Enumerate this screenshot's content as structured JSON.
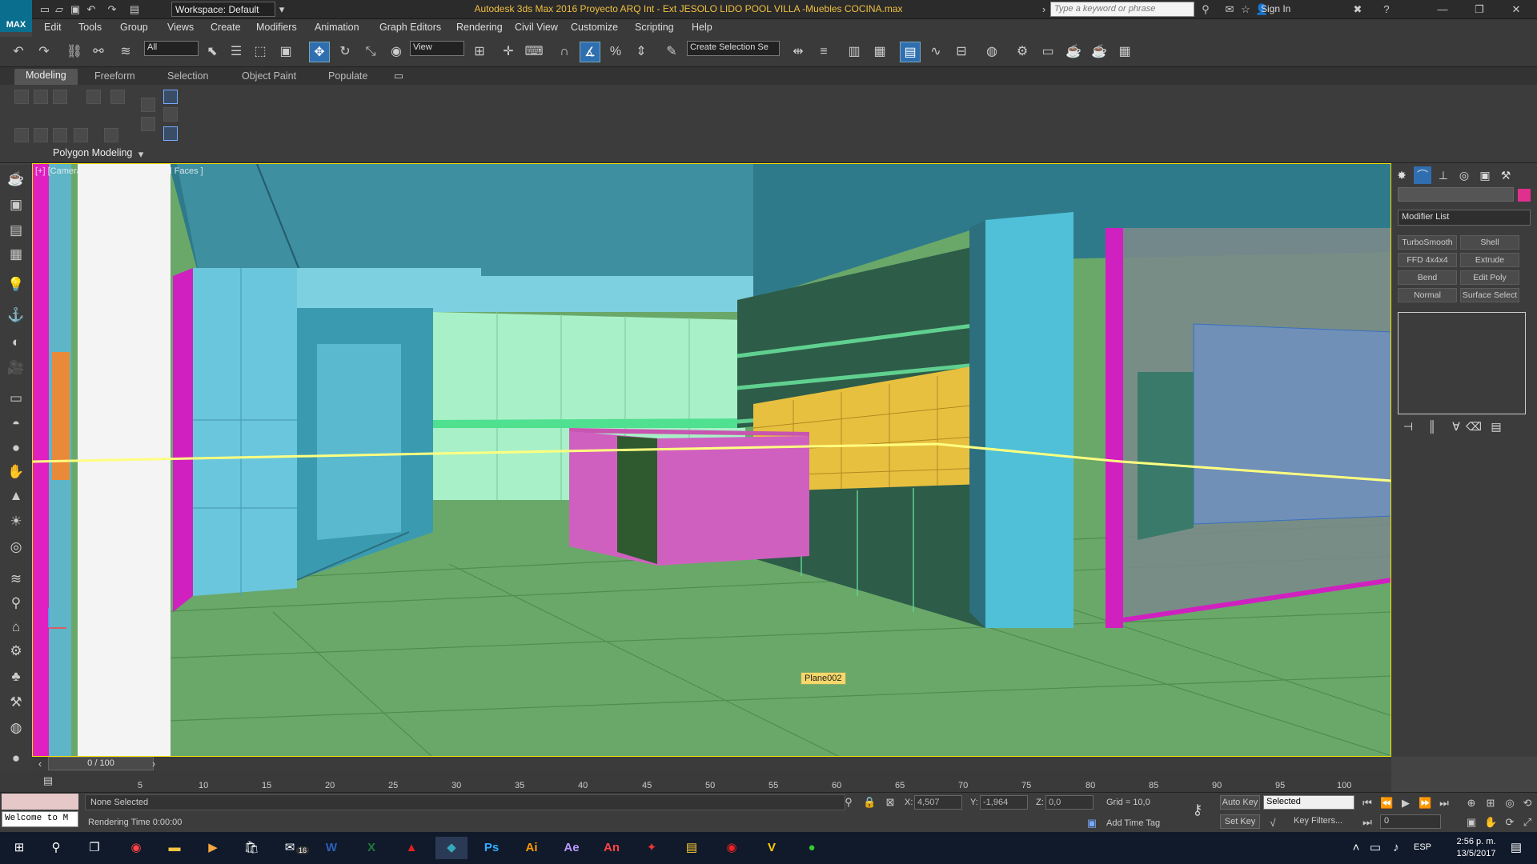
{
  "app": {
    "logo": "MAX",
    "workspace": "Workspace: Default",
    "title": "Autodesk 3ds Max 2016      Proyecto ARQ Int - Ext JESOLO LIDO POOL VILLA -Muebles COCINA.max",
    "search_placeholder": "Type a keyword or phrase",
    "sign_in": "Sign In"
  },
  "menu": [
    "Edit",
    "Tools",
    "Group",
    "Views",
    "Create",
    "Modifiers",
    "Animation",
    "Graph Editors",
    "Rendering",
    "Civil View",
    "Customize",
    "Scripting",
    "Help"
  ],
  "toolbar": {
    "filter_value": "All",
    "ref_coord": "View",
    "selection_set": "Create Selection Se"
  },
  "ribbon": {
    "tabs": [
      "Modeling",
      "Freeform",
      "Selection",
      "Object Paint",
      "Populate"
    ],
    "panel_label": "Polygon Modeling"
  },
  "viewport": {
    "label": "[+] [Camera008 ] [Shaded + Edged Faces ]",
    "object_label": "Plane002"
  },
  "command_panel": {
    "modifier_list": "Modifier List",
    "modifiers": [
      "TurboSmooth",
      "Shell",
      "FFD 4x4x4",
      "Extrude",
      "Bend",
      "Edit Poly",
      "Normal",
      "Surface Select"
    ],
    "object_color": "#e0308e"
  },
  "timeline": {
    "frame": "0 / 100",
    "ticks": [
      "5",
      "10",
      "15",
      "20",
      "25",
      "30",
      "35",
      "40",
      "45",
      "50",
      "55",
      "60",
      "65",
      "70",
      "75",
      "80",
      "85",
      "90",
      "95",
      "100"
    ]
  },
  "status": {
    "welcome": "Welcome to M",
    "selection": "None Selected",
    "render_time": "Rendering Time  0:00:00",
    "x_label": "X:",
    "x_value": "4,507",
    "y_label": "Y:",
    "y_value": "-1,964",
    "z_label": "Z:",
    "z_value": "0,0",
    "grid": "Grid = 10,0",
    "add_time_tag": "Add Time Tag",
    "auto_key": "Auto Key",
    "set_key": "Set Key",
    "key_mode": "Selected",
    "key_filters": "Key Filters...",
    "current_frame": "0"
  },
  "taskbar": {
    "mail_badge": "16",
    "lang": "ESP",
    "time": "2:56 p. m.",
    "date": "13/5/2017"
  }
}
